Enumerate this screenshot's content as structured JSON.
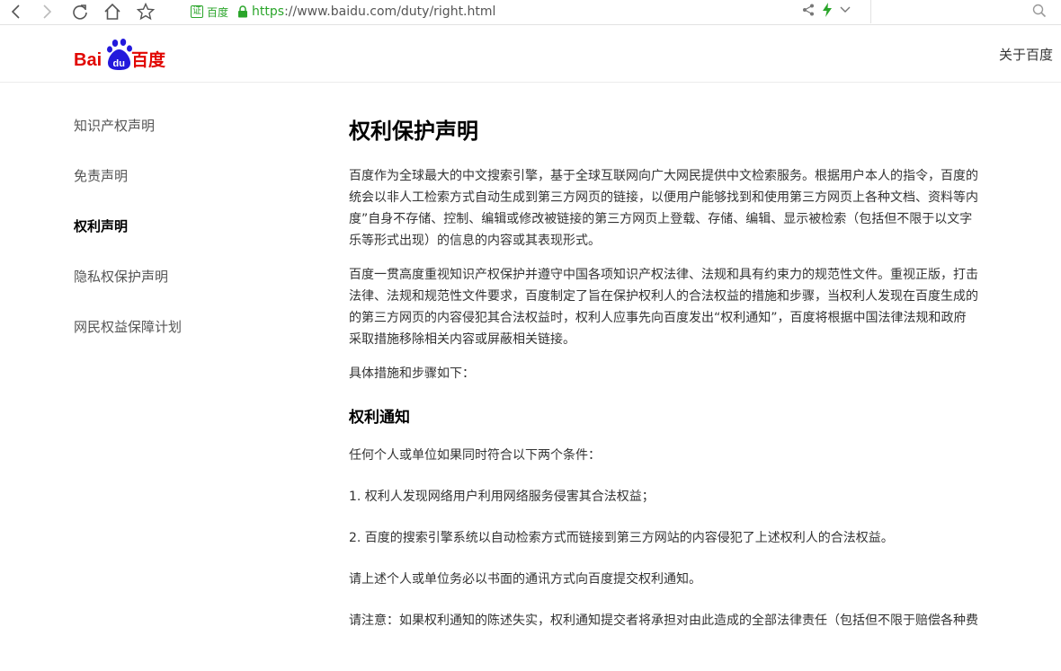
{
  "browser": {
    "cert_label": "证",
    "cert_site": "百度",
    "url_https": "https",
    "url_rest": "://www.baidu.com/duty/right.html"
  },
  "header": {
    "logo_alt": "Bai du 百度",
    "about": "关于百度"
  },
  "sidebar": {
    "items": [
      {
        "label": "知识产权声明"
      },
      {
        "label": "免责声明"
      },
      {
        "label": "权利声明"
      },
      {
        "label": "隐私权保护声明"
      },
      {
        "label": "网民权益保障计划"
      }
    ]
  },
  "main": {
    "title": "权利保护声明",
    "p1_lines": [
      "百度作为全球最大的中文搜索引擎，基于全球互联网向广大网民提供中文检索服务。根据用户本人的指令，百度的",
      "统会以非人工检索方式自动生成到第三方网页的链接，以便用户能够找到和使用第三方网页上各种文档、资料等内",
      "度”自身不存储、控制、编辑或修改被链接的第三方网页上登载、存储、编辑、显示被检索（包括但不限于以文字",
      "乐等形式出现）的信息的内容或其表现形式。"
    ],
    "p2_lines": [
      "百度一贯高度重视知识产权保护并遵守中国各项知识产权法律、法规和具有约束力的规范性文件。重视正版，打击",
      "法律、法规和规范性文件要求，百度制定了旨在保护权利人的合法权益的措施和步骤，当权利人发现在百度生成的",
      "的第三方网页的内容侵犯其合法权益时，权利人应事先向百度发出“权利通知”，百度将根据中国法律法规和政府",
      "采取措施移除相关内容或屏蔽相关链接。"
    ],
    "p3": "具体措施和步骤如下：",
    "section_title": "权利通知",
    "p4": "任何个人或单位如果同时符合以下两个条件：",
    "p5": "1. 权利人发现网络用户利用网络服务侵害其合法权益；",
    "p6": "2. 百度的搜索引擎系统以自动检索方式而链接到第三方网站的内容侵犯了上述权利人的合法权益。",
    "p7": "请上述个人或单位务必以书面的通讯方式向百度提交权利通知。",
    "p8": "请注意：如果权利通知的陈述失实，权利通知提交者将承担对由此造成的全部法律责任（包括但不限于赔偿各种费"
  },
  "colors": {
    "accent_green": "#2aa52a",
    "baidu_red": "#e10601",
    "baidu_blue": "#2319dc"
  }
}
